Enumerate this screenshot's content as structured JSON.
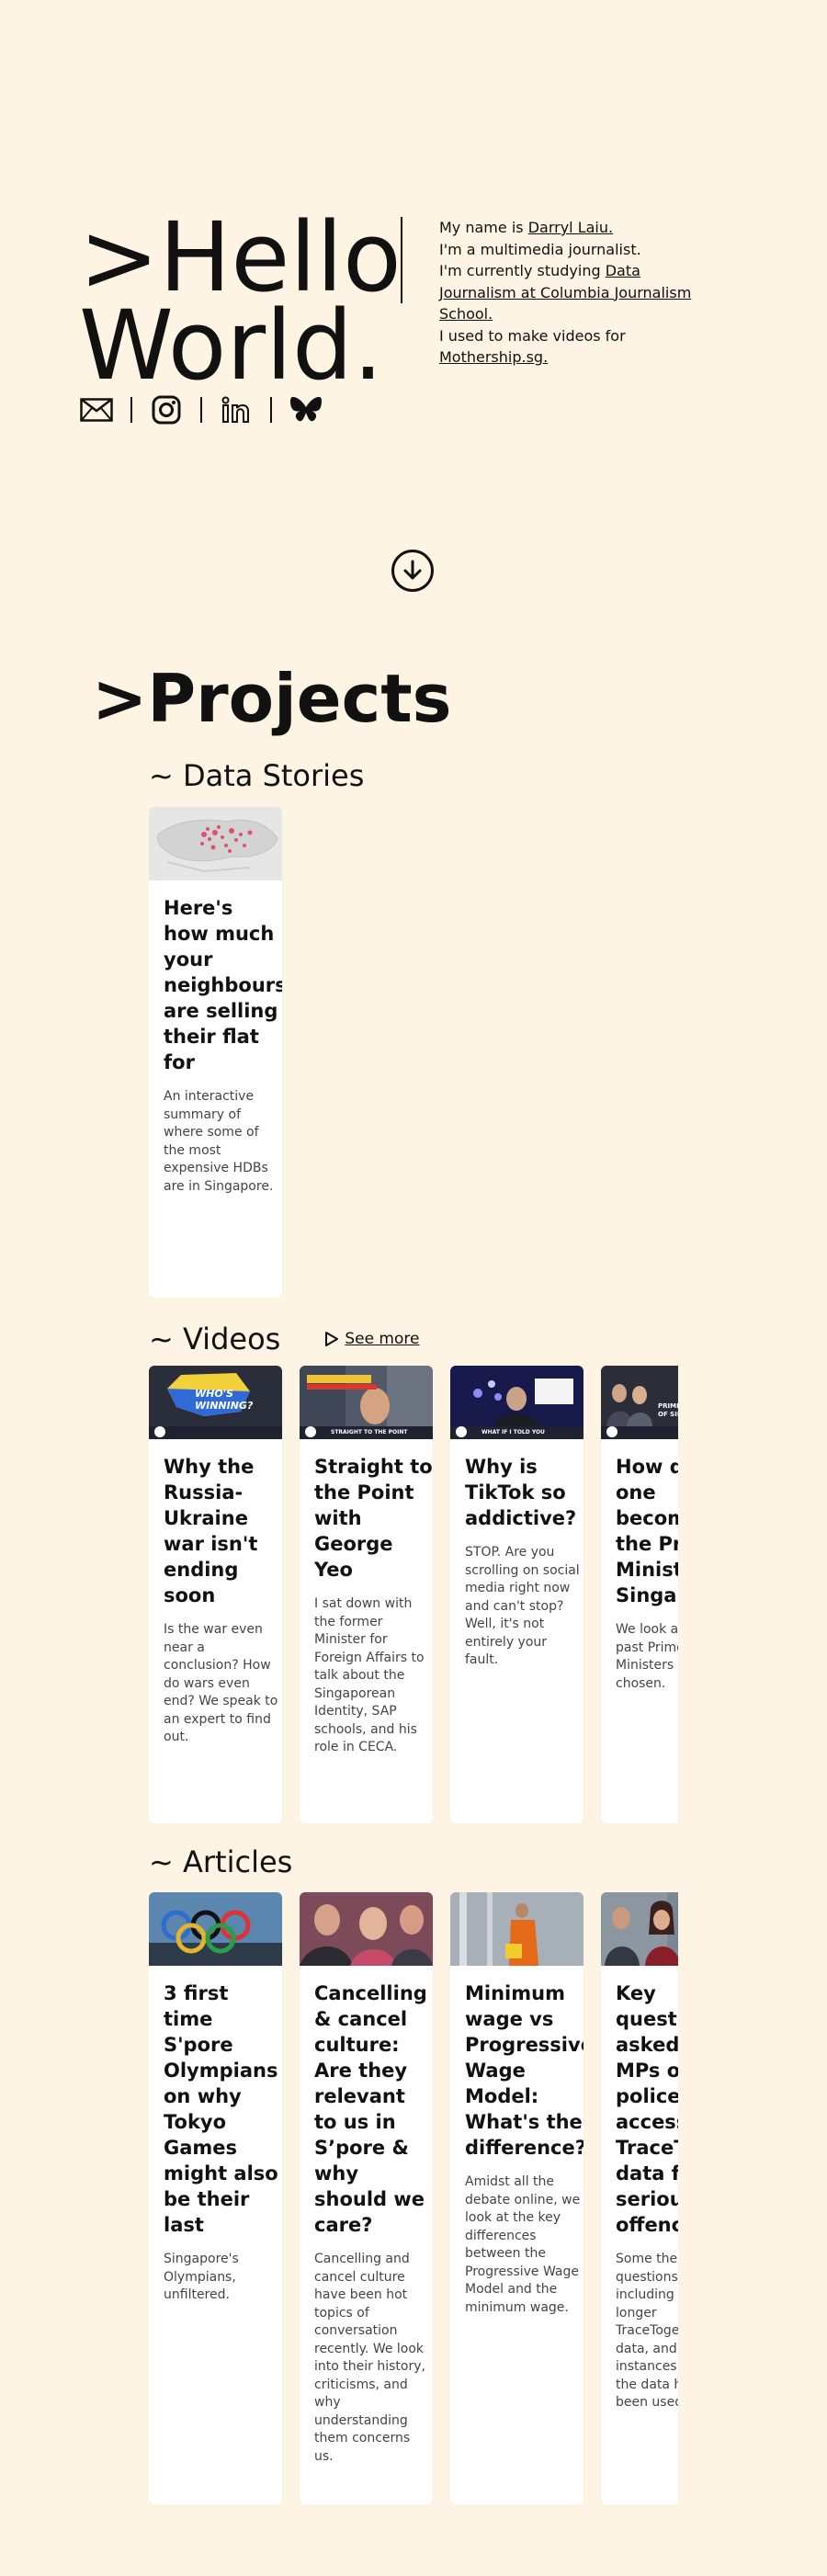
{
  "hero": {
    "title_line1": ">Hello",
    "title_line2": "World.",
    "intro": {
      "line1_prefix": "My name is ",
      "name_link": "Darryl Laiu.",
      "line2": "I'm a multimedia journalist.",
      "line3_prefix": "I'm currently studying ",
      "study_link": "Data Journalism at Columbia Journalism School.",
      "line4_prefix": "I used to make videos for ",
      "work_link": "Mothership.sg."
    },
    "socials": [
      "mail-icon",
      "instagram-icon",
      "linkedin-icon",
      "bluesky-icon"
    ],
    "separator": "|"
  },
  "projects": {
    "title": ">Projects",
    "data_stories": {
      "heading": "~ Data Stories",
      "items": [
        {
          "title": "Here's how much your neighbours are selling their flat for",
          "desc": "An interactive summary of where some of the most expensive HDBs are in Singapore."
        }
      ]
    },
    "videos": {
      "heading": "~ Videos",
      "see_more": "See more",
      "items": [
        {
          "title": "Why the Russia-Ukraine war isn't ending soon",
          "desc": "Is the war even near a conclusion? How do wars even end? We speak to an expert to find out.",
          "thumb_text": "WHO'S WINNING?"
        },
        {
          "title": "Straight to the Point with George Yeo",
          "desc": "I sat down with the former Minister for Foreign Affairs to talk about the Singaporean Identity, SAP schools, and his role in CECA.",
          "thumb_text": "STRAIGHT TO THE POINT"
        },
        {
          "title": "Why is TikTok so addictive?",
          "desc": "STOP. Are you scrolling on social media right now and can't stop? Well, it's not entirely your fault.",
          "thumb_text": "WHAT IF I TOLD YOU"
        },
        {
          "title": "How does one become the Prime Minister of Singapore?",
          "desc": "We look at how past Prime Ministers were chosen.",
          "thumb_text": "PRIME MINISTER OF SINGAPORE"
        }
      ]
    },
    "articles": {
      "heading": "~ Articles",
      "items": [
        {
          "title": "3 first time S'pore Olympians on why Tokyo Games might also be their last",
          "desc": "Singapore's Olympians, unfiltered."
        },
        {
          "title": "Cancelling & cancel culture: Are they relevant to us in S’pore & why should we care?",
          "desc": "Cancelling and cancel culture have been hot topics of conversation recently. We look into their history, criticisms, and why understanding them concerns us."
        },
        {
          "title": "Minimum wage vs Progressive Wage Model: What's the difference?",
          "desc": "Amidst all the debate online, we look at the key differences between the Progressive Wage Model and the minimum wage."
        },
        {
          "title": "Key questions asked by MPs on police access to TraceTogether data for serious offences",
          "desc": "Some the key questions raised including the longer TraceTogether data, and instances where the data have been used."
        }
      ]
    }
  }
}
